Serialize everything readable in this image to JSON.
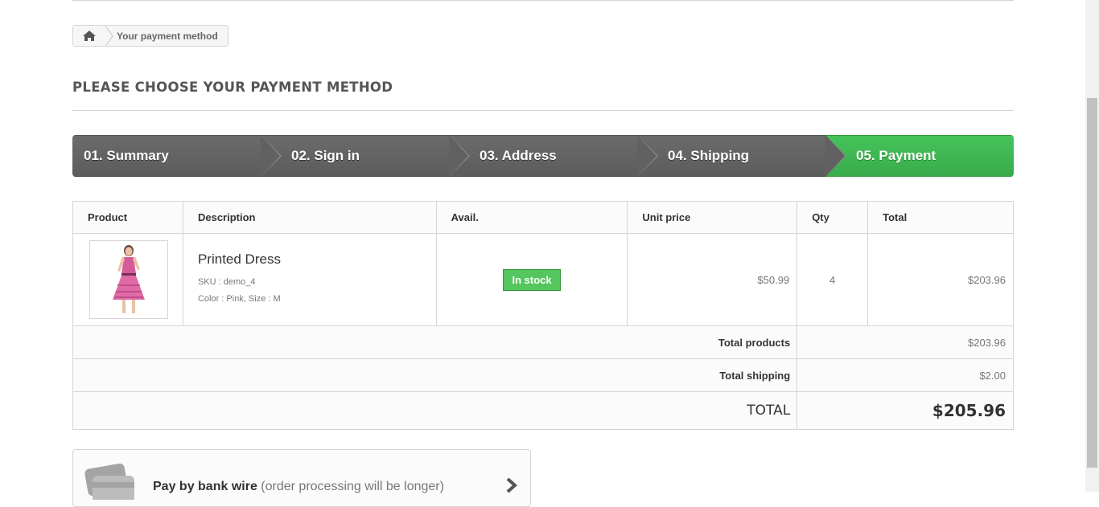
{
  "breadcrumb": {
    "home_icon": "home-icon",
    "current": "Your payment method"
  },
  "page_heading": "PLEASE CHOOSE YOUR PAYMENT METHOD",
  "steps": [
    {
      "label": "01. Summary"
    },
    {
      "label": "02. Sign in"
    },
    {
      "label": "03. Address"
    },
    {
      "label": "04. Shipping"
    },
    {
      "label": "05. Payment",
      "current": true
    }
  ],
  "colors": {
    "step_inactive": "#616161",
    "step_current": "#41b652",
    "in_stock": "#55c65e"
  },
  "cart": {
    "headers": [
      "Product",
      "Description",
      "Avail.",
      "Unit price",
      "Qty",
      "Total"
    ],
    "item": {
      "name": "Printed Dress",
      "sku": "SKU : demo_4",
      "attributes": "Color : Pink, Size : M",
      "availability": "In stock",
      "unit_price": "$50.99",
      "qty": "4",
      "total": "$203.96"
    },
    "total_products_label": "Total products",
    "total_products": "$203.96",
    "total_shipping_label": "Total shipping",
    "total_shipping": "$2.00",
    "total_label": "TOTAL",
    "total": "$205.96"
  },
  "payment": {
    "title": "Pay by bank wire",
    "note": "(order processing will be longer)",
    "icon": "bank-card-icon"
  }
}
